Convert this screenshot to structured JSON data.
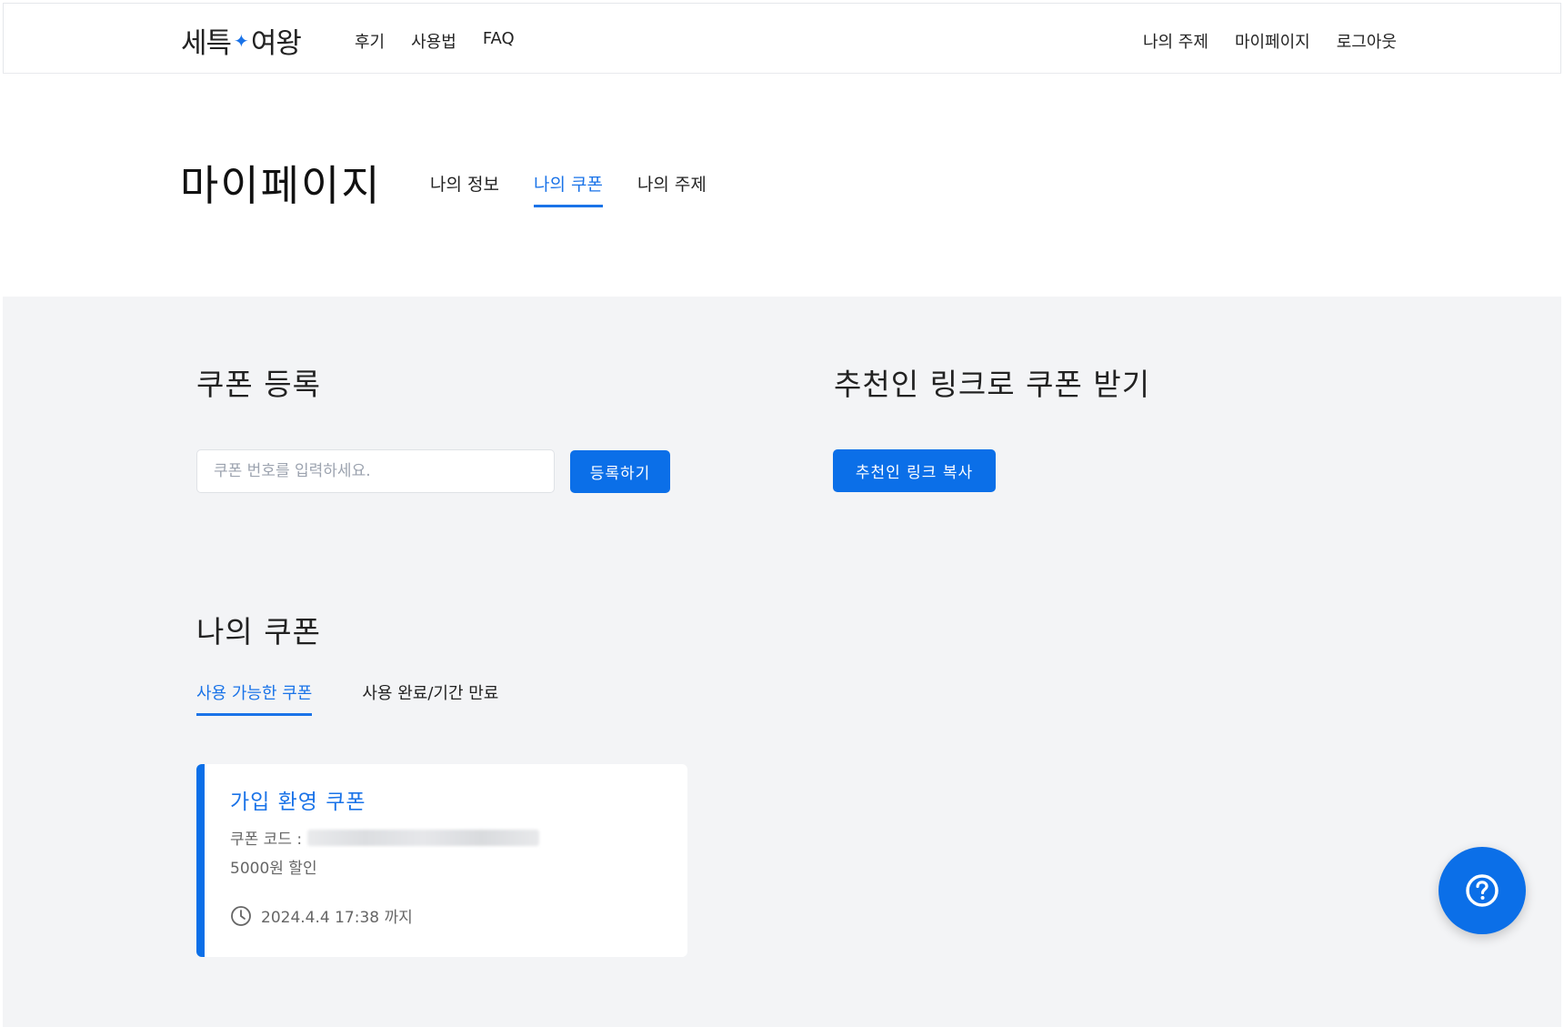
{
  "header": {
    "logo_left": "세특",
    "logo_right": "여왕",
    "nav_left": [
      "후기",
      "사용법",
      "FAQ"
    ],
    "nav_right": [
      "나의 주제",
      "마이페이지",
      "로그아웃"
    ]
  },
  "page": {
    "title": "마이페이지",
    "tabs": [
      "나의 정보",
      "나의 쿠폰",
      "나의 주제"
    ],
    "active_tab": "나의 쿠폰"
  },
  "coupon_register": {
    "title": "쿠폰 등록",
    "placeholder": "쿠폰 번호를 입력하세요.",
    "button": "등록하기"
  },
  "referral": {
    "title": "추천인 링크로 쿠폰 받기",
    "button": "추천인 링크 복사"
  },
  "my_coupons": {
    "title": "나의 쿠폰",
    "tabs": [
      "사용 가능한 쿠폰",
      "사용 완료/기간 만료"
    ],
    "active_tab": "사용 가능한 쿠폰",
    "items": [
      {
        "name": "가입 환영 쿠폰",
        "code_label": "쿠폰 코드 :",
        "discount": "5000원 할인",
        "expiry": "2024.4.4 17:38 까지"
      }
    ]
  },
  "icons": {
    "logo_star": "sparkle-icon",
    "clock": "clock-icon",
    "help": "help-circle-icon"
  },
  "colors": {
    "accent": "#0b6fe8",
    "background_content": "#f3f4f6"
  }
}
